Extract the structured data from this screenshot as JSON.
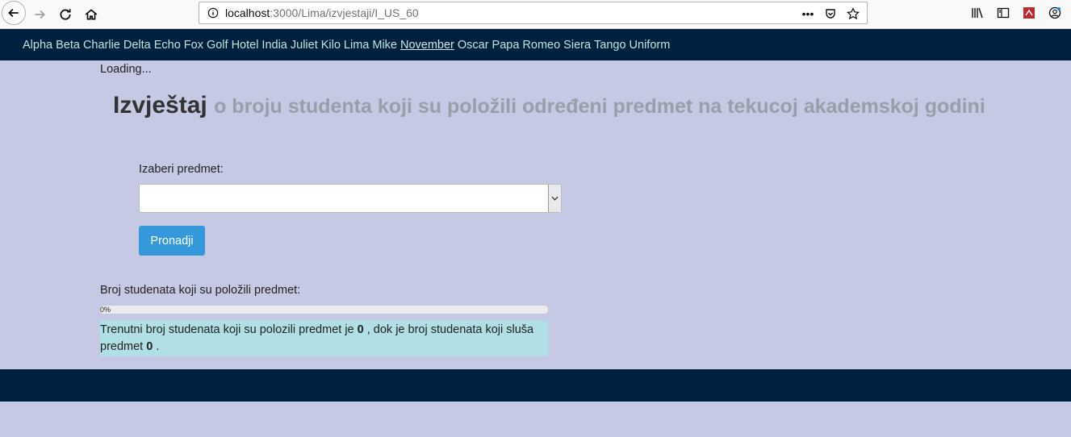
{
  "browser": {
    "url_host": "localhost",
    "url_path": ":3000/Lima/izvjestaji/I_US_60"
  },
  "nav": {
    "items": [
      "Alpha",
      "Beta",
      "Charlie",
      "Delta",
      "Echo",
      "Fox",
      "Golf",
      "Hotel",
      "India",
      "Juliet",
      "Kilo",
      "Lima",
      "Mike",
      "November",
      "Oscar",
      "Papa",
      "Romeo",
      "Siera",
      "Tango",
      "Uniform"
    ],
    "active": "November"
  },
  "page": {
    "loading": "Loading...",
    "title": "Izvještaj",
    "subtitle": "o broju studenta koji su položili određeni predmet na tekucoj akademskoj godini",
    "select_label": "Izaberi predmet:",
    "select_value": "",
    "button_label": "Pronadji",
    "count_label": "Broj studenata koji su položili predmet:",
    "progress_percent": 0,
    "progress_text": "0%",
    "info_part1": "Trenutni broj studenata koji su polozili predmet je ",
    "passed_count": "0",
    "info_part2": " , dok je broj studenata koji sluša predmet ",
    "enrolled_count": "0",
    "info_part3": " ."
  },
  "colors": {
    "navbar": "#002040",
    "background": "#c5c9e3",
    "button": "#3498db",
    "info_box": "#b0dfe5"
  }
}
